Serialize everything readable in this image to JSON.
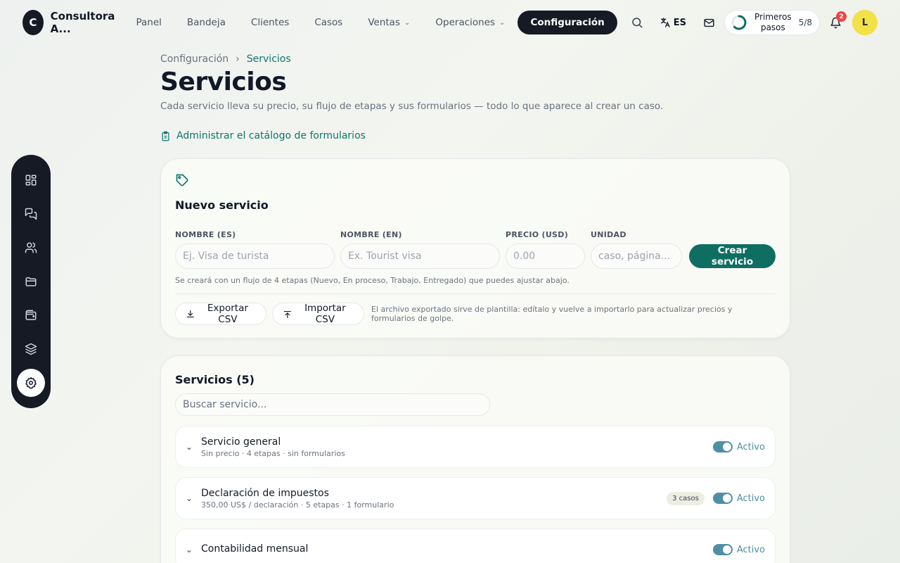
{
  "brand": {
    "logo_letter": "C",
    "name": "Consultora A..."
  },
  "nav": {
    "items": [
      {
        "label": "Panel"
      },
      {
        "label": "Bandeja"
      },
      {
        "label": "Clientes"
      },
      {
        "label": "Casos"
      },
      {
        "label": "Ventas"
      },
      {
        "label": "Operaciones"
      },
      {
        "label": "Configuración"
      }
    ],
    "active": "Configuración"
  },
  "topbar": {
    "language": "ES",
    "onboarding": {
      "label_line1": "Primeros",
      "label_line2": "pasos",
      "count": "5/8",
      "progress": 0.625
    },
    "notifications_count": "2",
    "avatar_letter": "L"
  },
  "sidebar": {
    "items": [
      {
        "icon": "grid-icon"
      },
      {
        "icon": "chat-icon"
      },
      {
        "icon": "users-icon"
      },
      {
        "icon": "folder-icon"
      },
      {
        "icon": "wallet-icon"
      },
      {
        "icon": "layers-icon"
      },
      {
        "icon": "gear-icon"
      }
    ],
    "active": "gear-icon"
  },
  "breadcrumb": {
    "parent": "Configuración",
    "current": "Servicios"
  },
  "page": {
    "title": "Servicios",
    "subtitle": "Cada servicio lleva su precio, su flujo de etapas y sus formularios — todo lo que aparece al crear un caso.",
    "catalog_link": "Administrar el catálogo de formularios"
  },
  "new_service": {
    "title": "Nuevo servicio",
    "fields": {
      "name_es": {
        "label": "NOMBRE (ES)",
        "placeholder": "Ej. Visa de turista",
        "value": ""
      },
      "name_en": {
        "label": "NOMBRE (EN)",
        "placeholder": "Ex. Tourist visa",
        "value": ""
      },
      "price": {
        "label": "PRECIO (USD)",
        "placeholder": "0.00",
        "value": ""
      },
      "unit": {
        "label": "UNIDAD",
        "placeholder": "caso, página...",
        "value": ""
      }
    },
    "create_label": "Crear servicio",
    "hint": "Se creará con un flujo de 4 etapas (Nuevo, En proceso, Trabajo, Entregado) que puedes ajustar abajo.",
    "export_label": "Exportar CSV",
    "import_label": "Importar CSV",
    "csv_note": "El archivo exportado sirve de plantilla: edítalo y vuelve a importarlo para actualizar precios y formularios de golpe."
  },
  "services": {
    "title": "Servicios (5)",
    "search_placeholder": "Buscar servicio...",
    "rows": [
      {
        "name": "Servicio general",
        "meta": "Sin precio · 4 etapas · sin formularios",
        "cases": "",
        "status": "Activo"
      },
      {
        "name": "Declaración de impuestos",
        "meta": "350,00 US$ / declaración · 5 etapas · 1 formulario",
        "cases": "3 casos",
        "status": "Activo"
      },
      {
        "name": "Contabilidad mensual",
        "meta": "",
        "cases": "",
        "status": "Activo"
      }
    ]
  },
  "colors": {
    "accent": "#0f6e62",
    "dark": "#151a24",
    "toggle": "#4f8fa6",
    "badge": "#ef4444",
    "avatar": "#f2e147"
  }
}
